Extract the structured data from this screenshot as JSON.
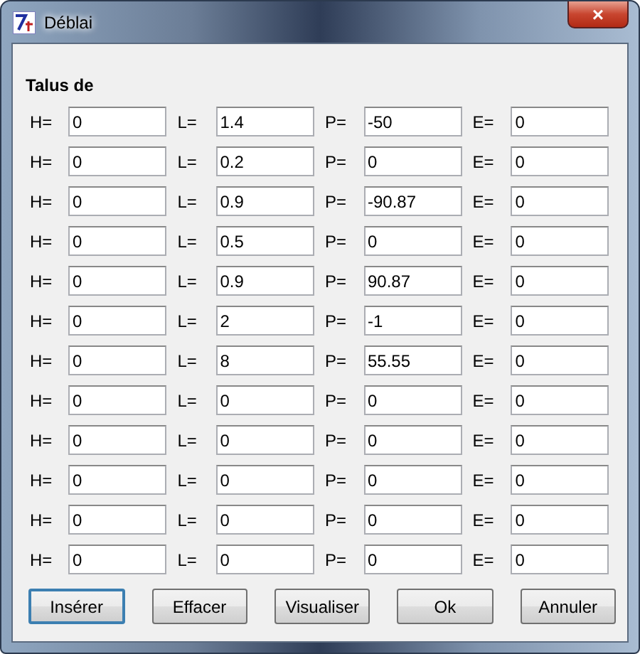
{
  "window": {
    "title": "Déblai",
    "close": "×"
  },
  "heading": "Talus de",
  "rows": [
    {
      "fields": [
        {
          "label": "H=",
          "value": "0"
        },
        {
          "label": "L=",
          "value": "1.4"
        },
        {
          "label": "P=",
          "value": "-50"
        },
        {
          "label": "E=",
          "value": "0"
        }
      ]
    },
    {
      "fields": [
        {
          "label": "H=",
          "value": "0"
        },
        {
          "label": "L=",
          "value": "0.2"
        },
        {
          "label": "P=",
          "value": "0"
        },
        {
          "label": "E=",
          "value": "0"
        }
      ]
    },
    {
      "fields": [
        {
          "label": "H=",
          "value": "0"
        },
        {
          "label": "L=",
          "value": "0.9"
        },
        {
          "label": "P=",
          "value": "-90.87"
        },
        {
          "label": "E=",
          "value": "0"
        }
      ]
    },
    {
      "fields": [
        {
          "label": "H=",
          "value": "0"
        },
        {
          "label": "L=",
          "value": "0.5"
        },
        {
          "label": "P=",
          "value": "0"
        },
        {
          "label": "E=",
          "value": "0"
        }
      ]
    },
    {
      "fields": [
        {
          "label": "H=",
          "value": "0"
        },
        {
          "label": "L=",
          "value": "0.9"
        },
        {
          "label": "P=",
          "value": "90.87"
        },
        {
          "label": "E=",
          "value": "0"
        }
      ]
    },
    {
      "fields": [
        {
          "label": "H=",
          "value": "0"
        },
        {
          "label": "L=",
          "value": "2"
        },
        {
          "label": "P=",
          "value": "-1"
        },
        {
          "label": "E=",
          "value": "0"
        }
      ]
    },
    {
      "fields": [
        {
          "label": "H=",
          "value": "0"
        },
        {
          "label": "L=",
          "value": "8"
        },
        {
          "label": "P=",
          "value": "55.55"
        },
        {
          "label": "E=",
          "value": "0"
        }
      ]
    },
    {
      "fields": [
        {
          "label": "H=",
          "value": "0"
        },
        {
          "label": "L=",
          "value": "0"
        },
        {
          "label": "P=",
          "value": "0"
        },
        {
          "label": "E=",
          "value": "0"
        }
      ]
    },
    {
      "fields": [
        {
          "label": "H=",
          "value": "0"
        },
        {
          "label": "L=",
          "value": "0"
        },
        {
          "label": "P=",
          "value": "0"
        },
        {
          "label": "E=",
          "value": "0"
        }
      ]
    },
    {
      "fields": [
        {
          "label": "H=",
          "value": "0"
        },
        {
          "label": "L=",
          "value": "0"
        },
        {
          "label": "P=",
          "value": "0"
        },
        {
          "label": "E=",
          "value": "0"
        }
      ]
    },
    {
      "fields": [
        {
          "label": "H=",
          "value": "0"
        },
        {
          "label": "L=",
          "value": "0"
        },
        {
          "label": "P=",
          "value": "0"
        },
        {
          "label": "E=",
          "value": "0"
        }
      ]
    },
    {
      "fields": [
        {
          "label": "H=",
          "value": "0"
        },
        {
          "label": "L=",
          "value": "0"
        },
        {
          "label": "P=",
          "value": "0"
        },
        {
          "label": "E=",
          "value": "0"
        }
      ]
    }
  ],
  "buttons": [
    "Insérer",
    "Effacer",
    "Visualiser",
    "Ok",
    "Annuler"
  ]
}
